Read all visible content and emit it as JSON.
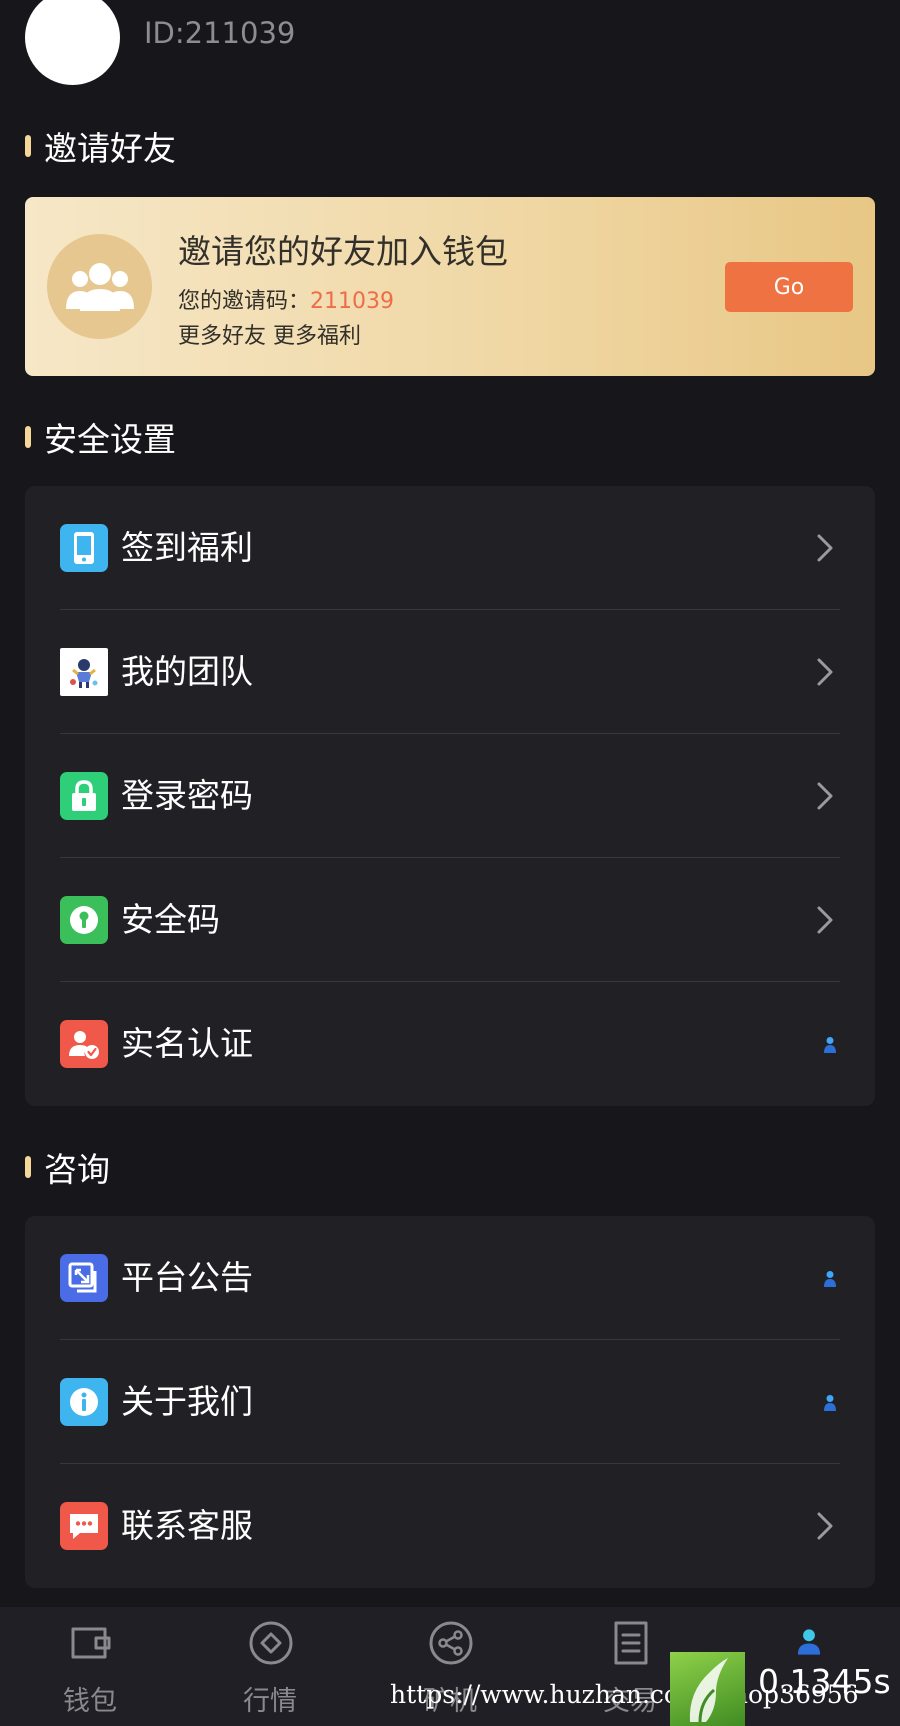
{
  "profile": {
    "user_id": "ID:211039"
  },
  "invite_section": {
    "title": "邀请好友",
    "card": {
      "headline": "邀请您的好友加入钱包",
      "code_label": "您的邀请码：",
      "code_value": "211039",
      "subtext": "更多好友 更多福利",
      "button_label": "Go",
      "colors": {
        "button": "#ef7242",
        "code": "#ee6d46",
        "card_start": "#f6e7c7",
        "card_end": "#e8c785"
      }
    }
  },
  "security_section": {
    "title": "安全设置",
    "items": [
      {
        "label": "签到福利",
        "icon": "phone-icon",
        "trailing": "chevron"
      },
      {
        "label": "我的团队",
        "icon": "team-illustration-icon",
        "trailing": "chevron"
      },
      {
        "label": "登录密码",
        "icon": "lock-icon",
        "trailing": "chevron"
      },
      {
        "label": "安全码",
        "icon": "keyhole-icon",
        "trailing": "chevron"
      },
      {
        "label": "实名认证",
        "icon": "verified-user-icon",
        "trailing": "person"
      }
    ]
  },
  "consult_section": {
    "title": "咨询",
    "items": [
      {
        "label": "平台公告",
        "icon": "announcement-icon",
        "trailing": "person"
      },
      {
        "label": "关于我们",
        "icon": "info-icon",
        "trailing": "person"
      },
      {
        "label": "联系客服",
        "icon": "chat-icon",
        "trailing": "chevron"
      }
    ]
  },
  "tabbar": {
    "items": [
      {
        "label": "钱包",
        "icon": "wallet-icon",
        "active": false
      },
      {
        "label": "行情",
        "icon": "diamond-icon",
        "active": false
      },
      {
        "label": "矿机",
        "icon": "share-nodes-icon",
        "active": false
      },
      {
        "label": "交易",
        "icon": "document-icon",
        "active": false
      },
      {
        "label": "",
        "icon": "user-icon",
        "active": true
      }
    ]
  },
  "overlay": {
    "watermark_url": "https://www.huzhan.com/ishop36956",
    "timer": "0.1345s"
  }
}
